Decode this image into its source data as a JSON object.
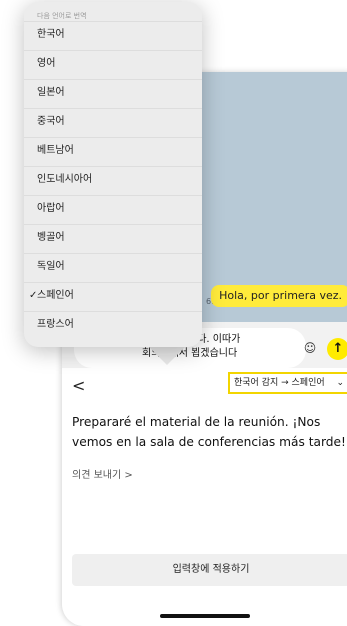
{
  "chat": {
    "bubble_text": "Hola, por primera vez.",
    "bubble_time": "6:26",
    "input_text": "준비하겠습니다. 이따가\n회의실에서 뵙겠습니다"
  },
  "input_bar": {
    "plus": "+",
    "emoji": "☺",
    "send": "↑"
  },
  "translate_panel": {
    "back": "<",
    "language_pair": "한국어 감지 → 스페인어",
    "chevron": "⌄",
    "translated_text": "Prepararé el material de la reunión. ¡Nos vemos en la sala de conferencias más tarde!",
    "feedback_link": "의견 보내기 >",
    "apply_button": "입력창에 적용하기"
  },
  "language_menu": {
    "header": "다음 언어로 번역",
    "selected_index": 9,
    "check": "✓",
    "items": [
      {
        "label": "한국어"
      },
      {
        "label": "영어"
      },
      {
        "label": "일본어"
      },
      {
        "label": "중국어"
      },
      {
        "label": "베트남어"
      },
      {
        "label": "인도네시아어"
      },
      {
        "label": "아랍어"
      },
      {
        "label": "벵골어"
      },
      {
        "label": "독일어"
      },
      {
        "label": "스페인어"
      },
      {
        "label": "프랑스어"
      }
    ]
  },
  "colors": {
    "accent_yellow": "#ffeb00",
    "highlight_border": "#f2d500",
    "chat_background": "#b7c9d6"
  }
}
